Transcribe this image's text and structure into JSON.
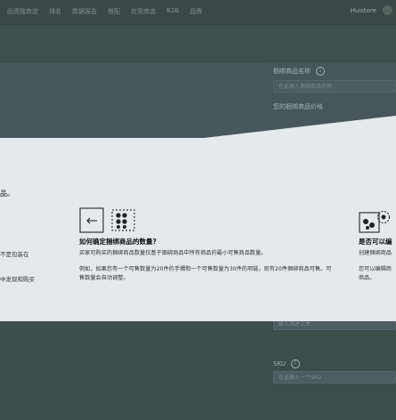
{
  "nav": {
    "items": [
      "品牌搜商店",
      "排名",
      "数据报告",
      "搭配",
      "应用商店",
      "B2B",
      "品牌"
    ],
    "brand": "Huistore"
  },
  "form": {
    "bundle_name_label": "捆绑商品名称",
    "bundle_name_placeholder": "在此输入捆绑商品名称",
    "bundle_price_label": "您的捆绑商品价格",
    "lower_input_placeholder": "输入描述文本",
    "sku_label": "SKU",
    "sku_placeholder": "在此输入一个SKU"
  },
  "banner": {
    "fragment_title": "品。",
    "left_fragment_1": "不是包装在",
    "left_fragment_2": "中发现和购买",
    "card_center": {
      "title": "如何确定捆绑商品的数量?",
      "desc1": "买家可购买的捆绑商品数量仅基于捆绑商品中所有商品的最小可售商品数量。",
      "desc2": "例如，如果您有一个可售数量为20件的手镯和一个可售数量为30件的项链，则有20件捆绑商品可售。可售数量会自动调整。"
    },
    "card_right": {
      "title": "是否可以编",
      "desc1": "创建捆绑商品",
      "desc2": "您可以编辑商",
      "desc3": "商品。"
    }
  },
  "colors": {
    "overlay": "#3f4f4c",
    "banner": "#e4eaeb",
    "text": "#111111"
  }
}
